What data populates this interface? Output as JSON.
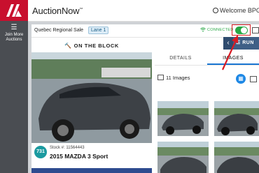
{
  "app": {
    "brand": "AuctionNow",
    "brand_mark": "™",
    "welcome": "Welcome BPGue"
  },
  "sidebar": {
    "join_label_line1": "Join More",
    "join_label_line2": "Auctions"
  },
  "sale": {
    "title": "Quebec Regional Sale",
    "lane": "Lane 1",
    "status": "CONNECTED"
  },
  "block": {
    "title": "ON THE BLOCK"
  },
  "vehicle": {
    "lot": "731",
    "stock": "Stock #: 11564443",
    "title": "2015 MAZDA 3 Sport"
  },
  "tabs": [
    "DETAILS",
    "IMAGES"
  ],
  "run": {
    "label": "RUN"
  },
  "images": {
    "count_label": "11 Images"
  },
  "colors": {
    "brand_red": "#c8102e",
    "connected_green": "#28a745",
    "accent_blue": "#1e88e5",
    "sidebar_gray": "#4a4d52"
  }
}
